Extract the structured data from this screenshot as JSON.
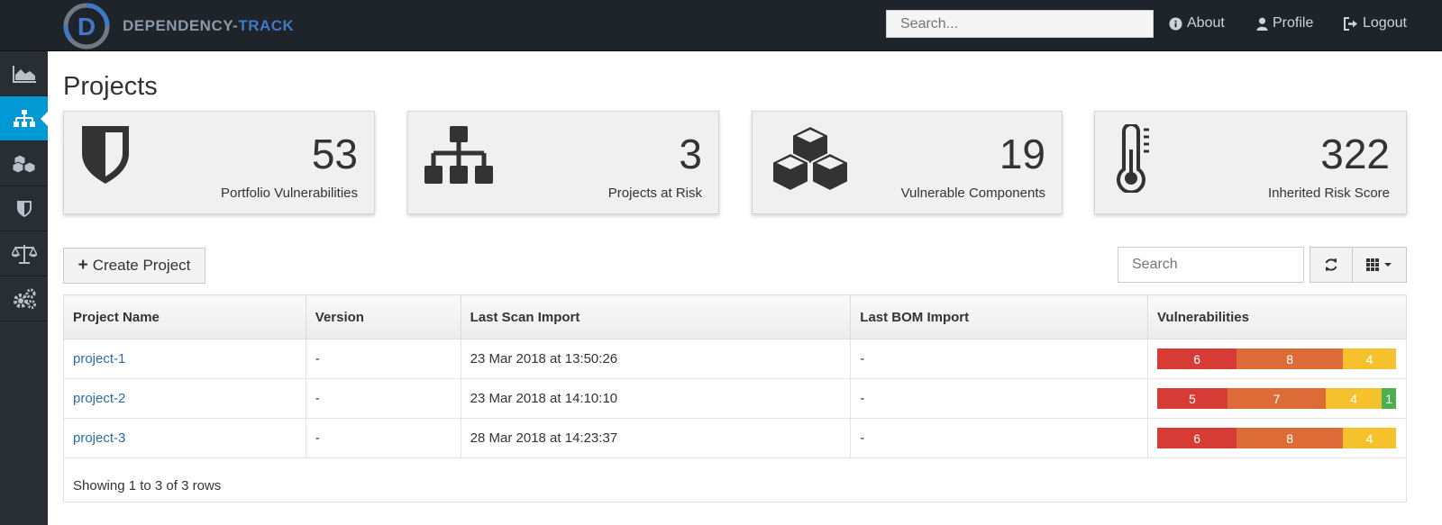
{
  "brand": {
    "part1": "DEPENDENCY-",
    "part2": "TRACK"
  },
  "nav": {
    "search_placeholder": "Search...",
    "about": "About",
    "profile": "Profile",
    "logout": "Logout"
  },
  "sidebar": {
    "items": [
      {
        "icon": "area-chart-icon"
      },
      {
        "icon": "sitemap-icon",
        "active": true
      },
      {
        "icon": "cubes-icon"
      },
      {
        "icon": "shield-icon"
      },
      {
        "icon": "balance-scale-icon"
      },
      {
        "icon": "gears-icon"
      }
    ]
  },
  "page": {
    "title": "Projects"
  },
  "cards": [
    {
      "value": "53",
      "label": "Portfolio Vulnerabilities",
      "icon": "shield-icon"
    },
    {
      "value": "3",
      "label": "Projects at Risk",
      "icon": "sitemap-icon"
    },
    {
      "value": "19",
      "label": "Vulnerable Components",
      "icon": "cubes-icon"
    },
    {
      "value": "322",
      "label": "Inherited Risk Score",
      "icon": "thermometer-icon"
    }
  ],
  "toolbar": {
    "create_label": "Create Project",
    "search_placeholder": "Search"
  },
  "table": {
    "columns": [
      "Project Name",
      "Version",
      "Last Scan Import",
      "Last BOM Import",
      "Vulnerabilities"
    ],
    "rows": [
      {
        "name": "project-1",
        "version": "-",
        "last_scan": "23 Mar 2018 at 13:50:26",
        "last_bom": "-",
        "vulns": {
          "critical": 6,
          "high": 8,
          "medium": 4,
          "low": 0
        }
      },
      {
        "name": "project-2",
        "version": "-",
        "last_scan": "23 Mar 2018 at 14:10:10",
        "last_bom": "-",
        "vulns": {
          "critical": 5,
          "high": 7,
          "medium": 4,
          "low": 1
        }
      },
      {
        "name": "project-3",
        "version": "-",
        "last_scan": "28 Mar 2018 at 14:23:37",
        "last_bom": "-",
        "vulns": {
          "critical": 6,
          "high": 8,
          "medium": 4,
          "low": 0
        }
      }
    ],
    "footer": "Showing 1 to 3 of 3 rows"
  },
  "colors": {
    "critical": "#d63b36",
    "high": "#dd6b37",
    "medium": "#f5c22d",
    "low": "#4caf50",
    "sidebar_active": "#0099d3",
    "navbar": "#1f232a"
  }
}
